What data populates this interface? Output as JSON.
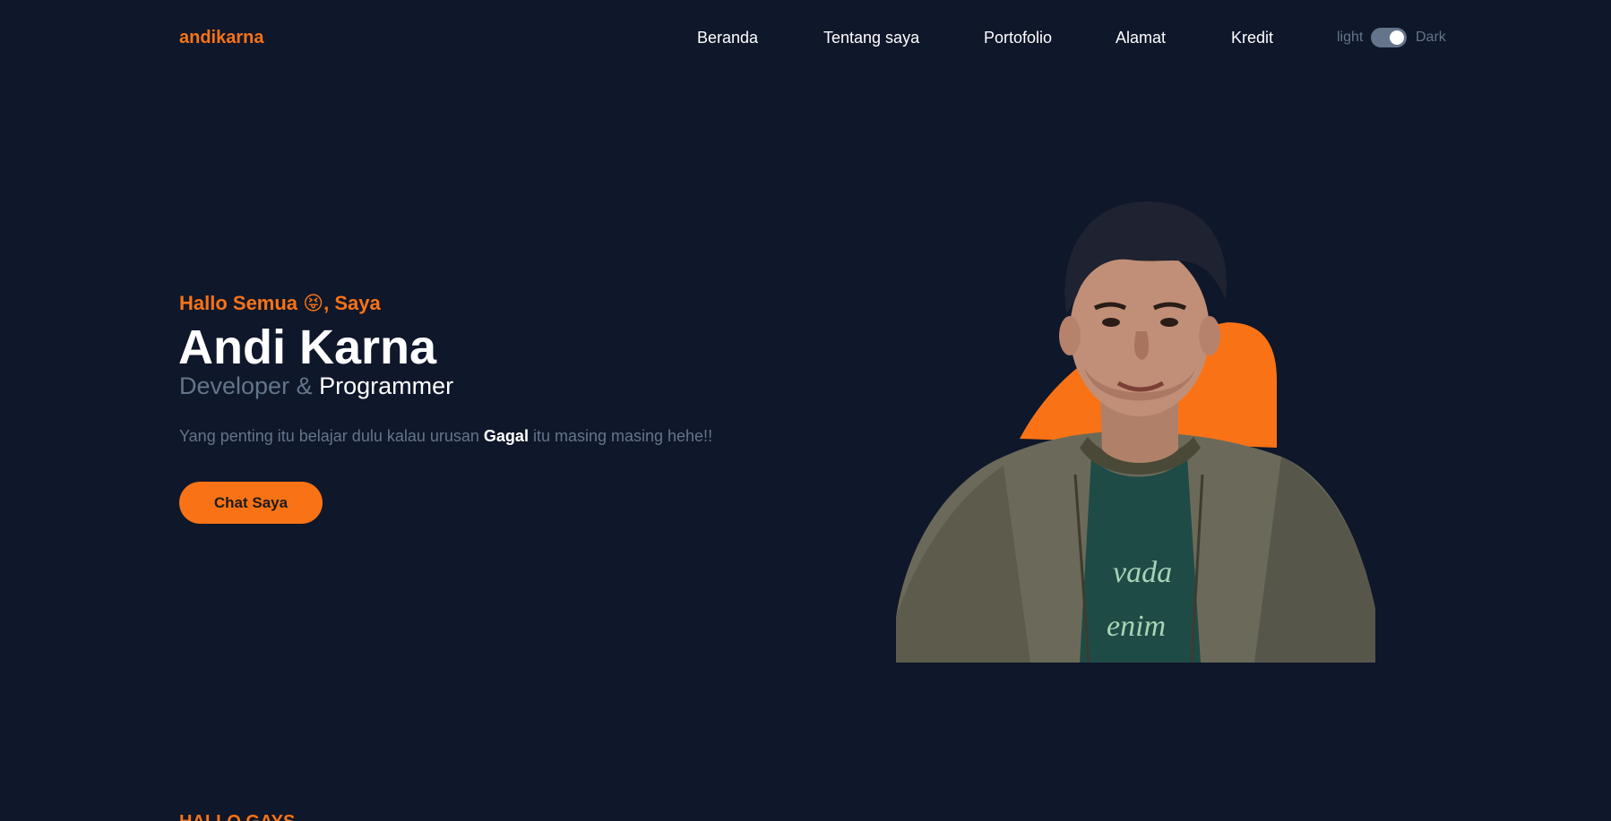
{
  "brand": "andikarna",
  "nav": {
    "items": [
      "Beranda",
      "Tentang saya",
      "Portofolio",
      "Alamat",
      "Kredit"
    ]
  },
  "theme_toggle": {
    "light_label": "light",
    "dark_label": "Dark",
    "state": "dark"
  },
  "hero": {
    "greeting_a": "Hallo Semua ",
    "greeting_emoji": "😝",
    "greeting_b": ", Saya",
    "name": "Andi Karna",
    "role_a": "Developer & ",
    "role_b": "Programmer",
    "desc_a": "Yang penting itu belajar dulu kalau urusan ",
    "desc_bold": "Gagal",
    "desc_b": " itu masing masing hehe!!",
    "cta_label": "Chat Saya"
  },
  "next_section": {
    "title": "HALLO GAYS"
  },
  "colors": {
    "background": "#0f172a",
    "accent": "#f97316",
    "muted": "#64748b",
    "text": "#ffffff"
  }
}
